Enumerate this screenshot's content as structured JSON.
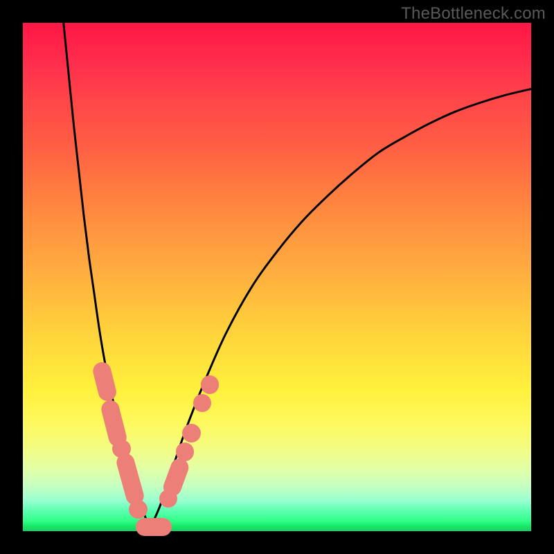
{
  "watermark": "TheBottleneck.com",
  "chart_data": {
    "type": "line",
    "title": "",
    "xlabel": "",
    "ylabel": "",
    "xlim": [
      0,
      100
    ],
    "ylim": [
      0,
      100
    ],
    "series": [
      {
        "name": "left-curve",
        "x": [
          8,
          9,
          10,
          11,
          12,
          13,
          14,
          15,
          16,
          17,
          18,
          19,
          20,
          21,
          22,
          23,
          24,
          25
        ],
        "values": [
          100,
          90,
          80,
          71,
          62,
          54,
          47,
          40,
          34,
          29,
          24.5,
          20,
          16,
          12.5,
          9,
          6,
          3,
          0.5
        ]
      },
      {
        "name": "right-curve",
        "x": [
          25,
          27,
          29,
          31,
          33,
          36,
          40,
          45,
          50,
          55,
          60,
          65,
          70,
          75,
          80,
          85,
          90,
          95,
          100
        ],
        "values": [
          0.5,
          5,
          11,
          17,
          22.5,
          30,
          39,
          48,
          55,
          61,
          66,
          70.5,
          74.5,
          77.5,
          80.2,
          82.5,
          84.3,
          85.8,
          87
        ]
      }
    ],
    "markers": {
      "capsules": [
        {
          "x1": 15.5,
          "y1": 31.5,
          "x2": 16.5,
          "y2": 27.5,
          "r": 1.8
        },
        {
          "x1": 17.2,
          "y1": 24.0,
          "x2": 18.6,
          "y2": 18.5,
          "r": 1.8
        },
        {
          "x1": 20.2,
          "y1": 13.5,
          "x2": 22.0,
          "y2": 7.0,
          "r": 1.8
        },
        {
          "x1": 24.0,
          "y1": 0.8,
          "x2": 27.5,
          "y2": 0.8,
          "r": 1.8
        },
        {
          "x1": 29.4,
          "y1": 8.7,
          "x2": 30.8,
          "y2": 12.5,
          "r": 1.8
        }
      ],
      "dots": [
        {
          "x": 19.4,
          "y": 16.2,
          "r": 1.8
        },
        {
          "x": 22.7,
          "y": 4.3,
          "r": 1.8
        },
        {
          "x": 28.6,
          "y": 6.4,
          "r": 1.8
        },
        {
          "x": 31.9,
          "y": 15.6,
          "r": 1.8
        },
        {
          "x": 33.2,
          "y": 19.3,
          "r": 1.8
        },
        {
          "x": 35.3,
          "y": 25.2,
          "r": 1.8
        },
        {
          "x": 36.8,
          "y": 28.8,
          "r": 1.8
        }
      ]
    }
  }
}
